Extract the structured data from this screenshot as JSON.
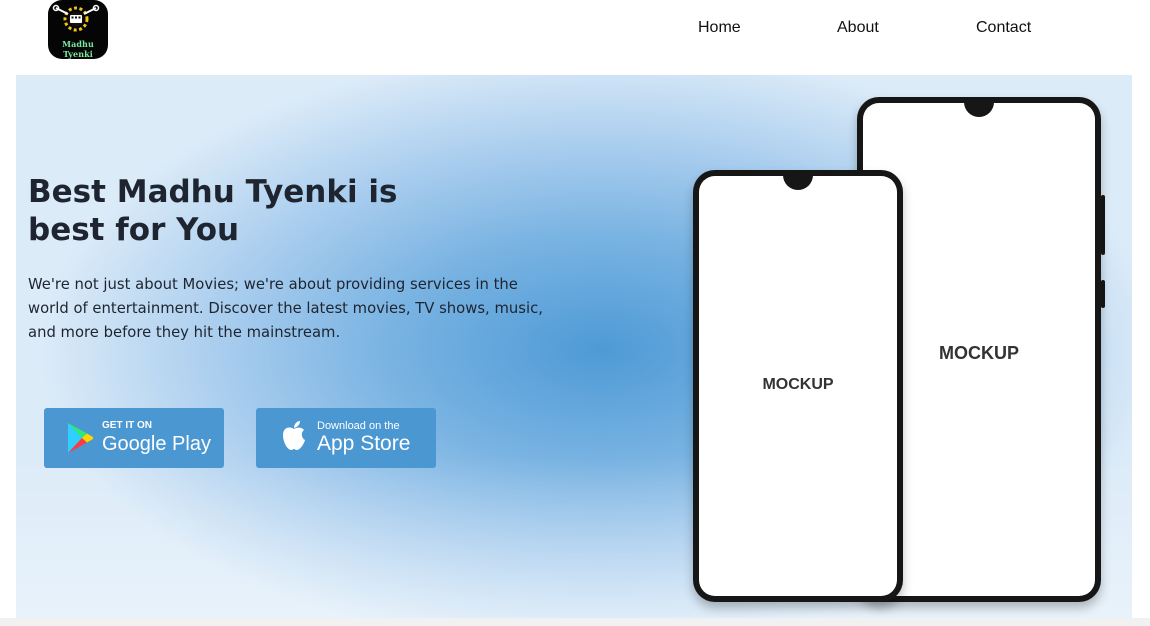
{
  "brand": {
    "logo_text": "Madhu Tyenki",
    "logo_icon": "gear-film-icon"
  },
  "nav": {
    "items": [
      {
        "label": "Home"
      },
      {
        "label": "About"
      },
      {
        "label": "Contact"
      }
    ]
  },
  "hero": {
    "title_line1": "Best Madhu Tyenki is",
    "title_line2": "best for You",
    "description": "We're not just about Movies; we're about providing services in the world of entertainment. Discover the latest movies, TV shows, music, and more before they hit the mainstream.",
    "google_play": {
      "small": "GET IT ON",
      "big": "Google Play",
      "icon": "google-play-icon"
    },
    "app_store": {
      "small": "Download on the",
      "big": "App Store",
      "icon": "apple-icon"
    },
    "mockup_back_label": "MOCKUP",
    "mockup_front_label": "MOCKUP"
  },
  "colors": {
    "button_bg": "#4b97d2",
    "hero_center": "#4e9ad6",
    "hero_edge": "#dcebf8"
  }
}
